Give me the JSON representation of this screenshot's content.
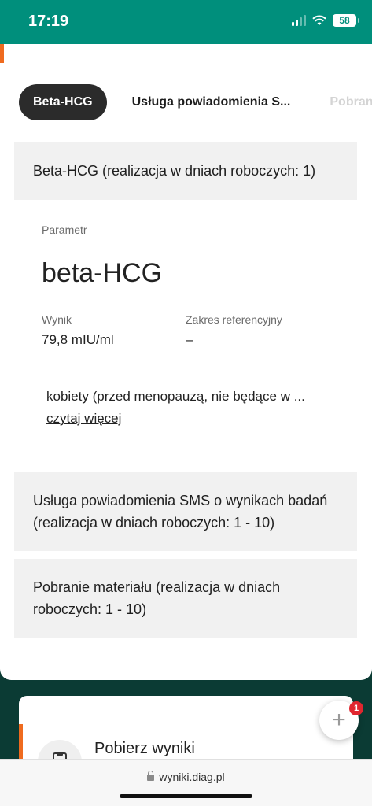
{
  "status_bar": {
    "time": "17:19",
    "battery": "58"
  },
  "tabs": [
    {
      "label": "Beta-HCG",
      "active": true
    },
    {
      "label": "Usługa powiadomienia S...",
      "active": false
    },
    {
      "label": "Pobranie",
      "active": false
    }
  ],
  "sections": [
    {
      "title": "Beta-HCG (realizacja w dniach roboczych: 1)"
    },
    {
      "title": "Usługa powiadomienia SMS o wynikach badań (realizacja w dniach roboczych: 1 - 10)"
    },
    {
      "title": "Pobranie materiału (realizacja w dniach roboczych: 1 - 10)"
    }
  ],
  "result": {
    "param_label": "Parametr",
    "param_name": "beta-HCG",
    "wynik_label": "Wynik",
    "wynik_value": "79,8 mIU/ml",
    "zakres_label": "Zakres referencyjny",
    "zakres_value": "–",
    "note": "kobiety (przed menopauzą, nie będące w ...",
    "read_more": "czytaj więcej"
  },
  "download": {
    "title": "Pobierz wyniki"
  },
  "fab": {
    "badge": "1"
  },
  "browser": {
    "url": "wyniki.diag.pl"
  },
  "colors": {
    "accent": "#008f7c",
    "orange": "#ef6b1f",
    "dark_bg": "#0b3b34"
  }
}
